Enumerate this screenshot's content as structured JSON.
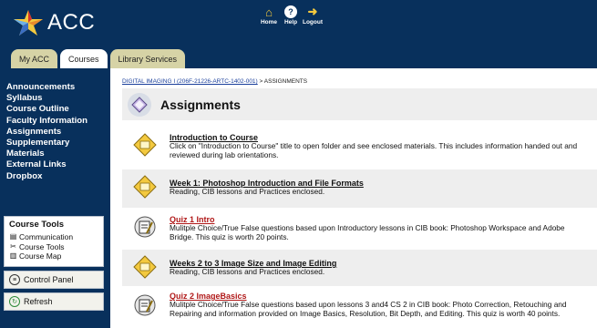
{
  "header": {
    "logo_text": "ACC",
    "nav": [
      {
        "label": "Home",
        "icon": "home-icon"
      },
      {
        "label": "Help",
        "icon": "help-icon"
      },
      {
        "label": "Logout",
        "icon": "logout-icon"
      }
    ],
    "bg_color": "#08305c",
    "accent": "#f3c93f"
  },
  "tabs": [
    {
      "label": "My ACC",
      "active": false
    },
    {
      "label": "Courses",
      "active": true
    },
    {
      "label": "Library Services",
      "active": false
    }
  ],
  "sidebar": {
    "links": [
      "Announcements",
      "Syllabus",
      "Course Outline",
      "Faculty Information",
      "Assignments",
      "Supplementary Materials",
      "External Links",
      "Dropbox"
    ],
    "tools": {
      "title": "Course Tools",
      "items": [
        {
          "label": "Communication",
          "icon": "communication-icon"
        },
        {
          "label": "Course Tools",
          "icon": "tools-icon"
        },
        {
          "label": "Course Map",
          "icon": "map-icon"
        }
      ]
    },
    "control_panel": "Control Panel",
    "refresh": "Refresh"
  },
  "main": {
    "breadcrumb_link": "DIGITAL IMAGING I (206F-21226-ARTC-1402-001)",
    "breadcrumb_current": " > ASSIGNMENTS",
    "title": "Assignments",
    "items": [
      {
        "type": "folder",
        "title": "Introduction to Course",
        "desc": "Click on \"Introduction to Course\" title to open folder and see enclosed materials. This includes information handed out and reviewed during lab orientations."
      },
      {
        "type": "folder",
        "title": "Week 1: Photoshop Introduction and File Formats",
        "desc": "Reading, CIB lessons and Practices enclosed."
      },
      {
        "type": "quiz",
        "title": "Quiz 1 Intro",
        "desc": "Mulitple Choice/True False questions based upon Introductory lessons in CIB book: Photoshop Workspace and Adobe Bridge. This quiz is worth 20 points."
      },
      {
        "type": "folder",
        "title": "Weeks 2 to 3 Image Size and Image Editing",
        "desc": "Reading, CIB lessons and Practices enclosed."
      },
      {
        "type": "quiz",
        "title": "Quiz 2 ImageBasics",
        "desc": "Mulitple Choice/True False questions based upon lessons 3 and4 CS 2 in CIB book: Photo Correction, Retouching and Repairing and information provided on Image Basics, Resolution, Bit Depth, and Editing. This quiz is worth 40 points."
      }
    ]
  }
}
